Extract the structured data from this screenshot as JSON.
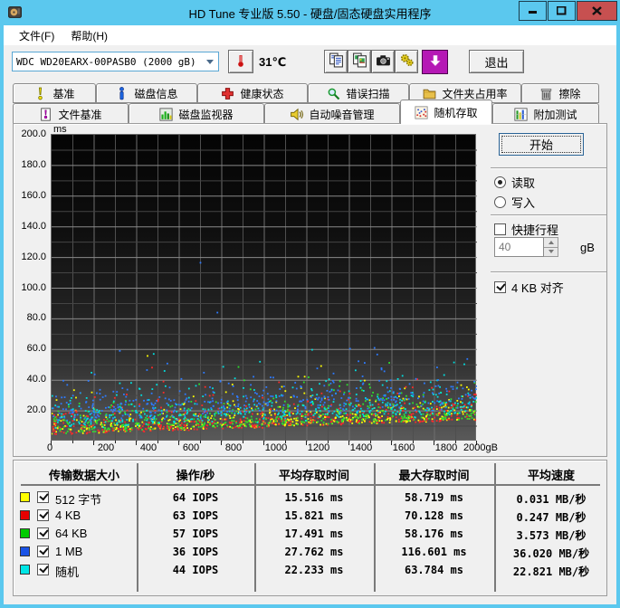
{
  "window": {
    "title": "HD Tune 专业版 5.50 - 硬盘/固态硬盘实用程序"
  },
  "menu": {
    "file": "文件(F)",
    "help": "帮助(H)"
  },
  "toolbar": {
    "drive_select": "WDC WD20EARX-00PASB0 (2000 gB)",
    "temperature": "31℃",
    "exit_label": "退出",
    "icons": [
      "thermometer-icon",
      "copy-text-icon",
      "copy-image-icon",
      "camera-icon",
      "options-gears-icon",
      "update-arrow-icon"
    ]
  },
  "tabs": {
    "row1": [
      {
        "label": "基准",
        "icon": "exclamation-icon"
      },
      {
        "label": "磁盘信息",
        "icon": "info-icon"
      },
      {
        "label": "健康状态",
        "icon": "health-cross-icon"
      },
      {
        "label": "错误扫描",
        "icon": "magnifier-icon"
      },
      {
        "label": "文件夹占用率",
        "icon": "folder-icon"
      },
      {
        "label": "擦除",
        "icon": "trash-icon"
      }
    ],
    "row2": [
      {
        "label": "文件基准",
        "icon": "file-exclamation-icon"
      },
      {
        "label": "磁盘监视器",
        "icon": "bar-chart-icon"
      },
      {
        "label": "自动噪音管理",
        "icon": "speaker-icon"
      },
      {
        "label": "随机存取",
        "icon": "scatter-dots-icon"
      },
      {
        "label": "附加测试",
        "icon": "extra-tests-icon"
      }
    ],
    "active": "随机存取"
  },
  "controls": {
    "start_label": "开始",
    "read_label": "读取",
    "write_label": "写入",
    "read_selected": true,
    "short_stroke_label": "快捷行程",
    "short_stroke_checked": false,
    "short_stroke_value": "40",
    "short_stroke_unit": "gB",
    "align_label": "4 KB 对齐",
    "align_checked": true
  },
  "chart_data": {
    "type": "scatter",
    "title": "随机存取时间散点图",
    "xlabel": "gB",
    "ylabel": "ms",
    "xlim": [
      0,
      2000
    ],
    "ylim": [
      0,
      200
    ],
    "x_major_step": 200,
    "x_minor_step": 100,
    "y_major_step": 20,
    "y_minor_step": 10,
    "x_unit": "gB",
    "y_unit": "ms",
    "grid": true,
    "legend_position": "table-below",
    "envelope_ms": {
      "start": 3.5,
      "end": 13
    },
    "seed": 7,
    "dot_size": 1.8,
    "series": [
      {
        "name": "512 字节",
        "color": "#ffff00",
        "count": 430,
        "offset_ms": 1.3,
        "spread_ms": 6.0,
        "avg_ms": 15.516,
        "max_ms": 58.719
      },
      {
        "name": "4 KB",
        "color": "#ff2a2a",
        "count": 430,
        "offset_ms": 1.0,
        "spread_ms": 6.5,
        "avg_ms": 15.821,
        "max_ms": 70.128
      },
      {
        "name": "64 KB",
        "color": "#2ee02e",
        "count": 430,
        "offset_ms": 2.2,
        "spread_ms": 7.0,
        "avg_ms": 17.491,
        "max_ms": 58.176
      },
      {
        "name": "随机",
        "color": "#00e0e0",
        "count": 400,
        "offset_ms": 6.5,
        "spread_ms": 7.5,
        "avg_ms": 22.233,
        "max_ms": 63.784
      },
      {
        "name": "1 MB",
        "color": "#2d7bff",
        "count": 400,
        "offset_ms": 12.5,
        "spread_ms": 7.0,
        "avg_ms": 27.762,
        "max_ms": 116.601,
        "outliers": [
          [
            700,
            116.601
          ]
        ]
      }
    ]
  },
  "table": {
    "headers": [
      "传输数据大小",
      "操作/秒",
      "平均存取时间",
      "最大存取时间",
      "平均速度"
    ],
    "rows": [
      {
        "color": "#ffff00",
        "checked": true,
        "label": "512 字节",
        "iops": "64 IOPS",
        "avg": "15.516 ms",
        "max": "58.719 ms",
        "speed": "0.031 MB/秒"
      },
      {
        "color": "#e60000",
        "checked": true,
        "label": "4 KB",
        "iops": "63 IOPS",
        "avg": "15.821 ms",
        "max": "70.128 ms",
        "speed": "0.247 MB/秒"
      },
      {
        "color": "#00cc00",
        "checked": true,
        "label": "64 KB",
        "iops": "57 IOPS",
        "avg": "17.491 ms",
        "max": "58.176 ms",
        "speed": "3.573 MB/秒"
      },
      {
        "color": "#1a53e6",
        "checked": true,
        "label": "1 MB",
        "iops": "36 IOPS",
        "avg": "27.762 ms",
        "max": "116.601 ms",
        "speed": "36.020 MB/秒"
      },
      {
        "color": "#00e6e6",
        "checked": true,
        "label": "随机",
        "iops": "44 IOPS",
        "avg": "22.233 ms",
        "max": "63.784 ms",
        "speed": "22.821 MB/秒"
      }
    ]
  }
}
